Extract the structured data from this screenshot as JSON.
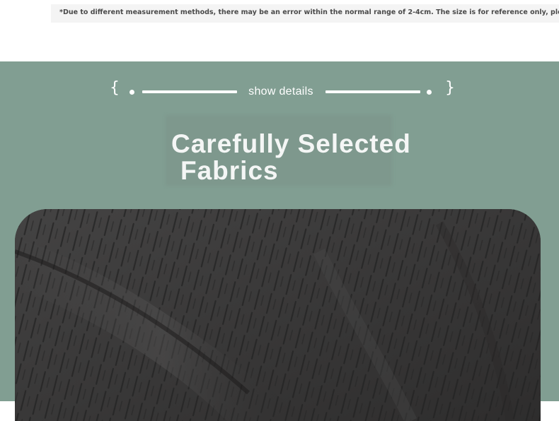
{
  "size_note": "*Due to different measurement methods, there may be an error within the normal range of 2-4cm. The size is for reference only, please refer to",
  "section": {
    "brace_open": "{",
    "brace_close": "}",
    "divider_label": "show details",
    "title_line1": "Carefully Selected",
    "title_line2": "Fabrics"
  },
  "colors": {
    "section_background": "#819e92",
    "fabric": "#3b3a3a"
  }
}
